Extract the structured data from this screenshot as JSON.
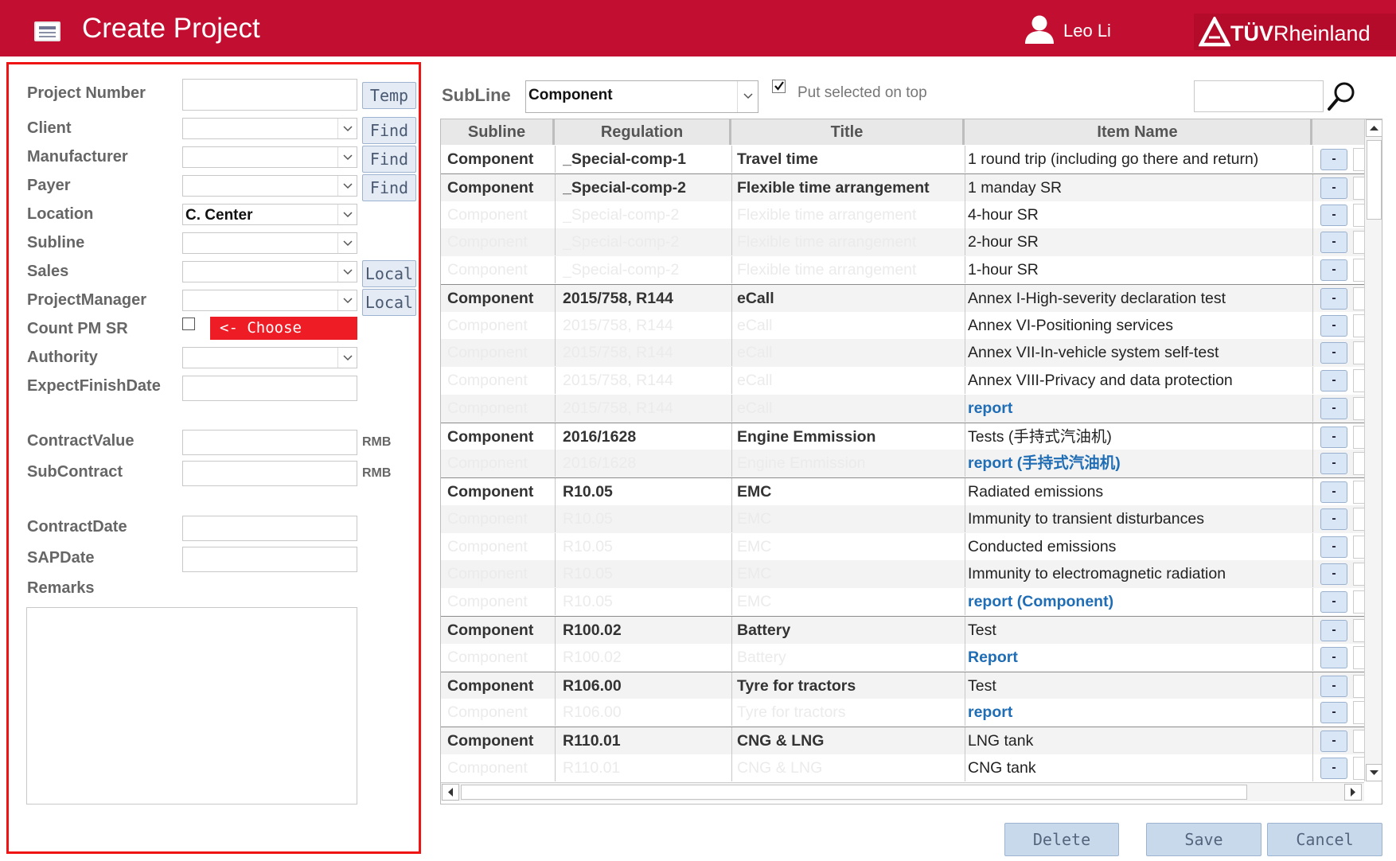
{
  "header": {
    "title": "Create Project",
    "user_name": "Leo Li",
    "logo_text_bold": "TÜV",
    "logo_text": "Rheinland"
  },
  "form": {
    "project_number": {
      "label": "Project Number",
      "value": "",
      "button": "Temp"
    },
    "client": {
      "label": "Client",
      "value": "",
      "button": "Find"
    },
    "manufacturer": {
      "label": "Manufacturer",
      "value": "",
      "button": "Find"
    },
    "payer": {
      "label": "Payer",
      "value": "",
      "button": "Find"
    },
    "location": {
      "label": "Location",
      "value": "C. Center"
    },
    "subline": {
      "label": "Subline",
      "value": ""
    },
    "sales": {
      "label": "Sales",
      "value": "",
      "button": "Local"
    },
    "project_manager": {
      "label": "ProjectManager",
      "value": "",
      "button": "Local"
    },
    "count_pm_sr": {
      "label": "Count PM SR",
      "checked": false,
      "hint": "<- Choose"
    },
    "authority": {
      "label": "Authority",
      "value": ""
    },
    "expect_finish_date": {
      "label": "ExpectFinishDate",
      "value": ""
    },
    "contract_value": {
      "label": "ContractValue",
      "value": "",
      "unit": "RMB"
    },
    "sub_contract": {
      "label": "SubContract",
      "value": "",
      "unit": "RMB"
    },
    "contract_date": {
      "label": "ContractDate",
      "value": ""
    },
    "sap_date": {
      "label": "SAPDate",
      "value": ""
    },
    "remarks": {
      "label": "Remarks",
      "value": ""
    }
  },
  "filter": {
    "subline_label": "SubLine",
    "subline_value": "Component",
    "put_selected_on_top_label": "Put selected on top",
    "put_selected_on_top_checked": true,
    "search_value": ""
  },
  "grid": {
    "columns": [
      "Subline",
      "Regulation",
      "Title",
      "Item Name"
    ],
    "row_button_label": "-",
    "rows": [
      {
        "subline": "Component",
        "regulation": "_Special-comp-1",
        "title": "Travel time",
        "item": "1 round trip (including go there and return)",
        "group_start": true,
        "link": false
      },
      {
        "subline": "Component",
        "regulation": "_Special-comp-2",
        "title": "Flexible time arrangement",
        "item": "1 manday SR",
        "group_start": true,
        "link": false
      },
      {
        "subline": "Component",
        "regulation": "_Special-comp-2",
        "title": "Flexible time arrangement",
        "item": "4-hour SR",
        "group_start": false,
        "link": false
      },
      {
        "subline": "Component",
        "regulation": "_Special-comp-2",
        "title": "Flexible time arrangement",
        "item": "2-hour SR",
        "group_start": false,
        "link": false
      },
      {
        "subline": "Component",
        "regulation": "_Special-comp-2",
        "title": "Flexible time arrangement",
        "item": "1-hour SR",
        "group_start": false,
        "link": false
      },
      {
        "subline": "Component",
        "regulation": "2015/758, R144",
        "title": "eCall",
        "item": "Annex I-High-severity declaration test",
        "group_start": true,
        "link": false
      },
      {
        "subline": "Component",
        "regulation": "2015/758, R144",
        "title": "eCall",
        "item": "Annex VI-Positioning services",
        "group_start": false,
        "link": false
      },
      {
        "subline": "Component",
        "regulation": "2015/758, R144",
        "title": "eCall",
        "item": "Annex VII-In-vehicle system self-test",
        "group_start": false,
        "link": false
      },
      {
        "subline": "Component",
        "regulation": "2015/758, R144",
        "title": "eCall",
        "item": "Annex VIII-Privacy and data protection",
        "group_start": false,
        "link": false
      },
      {
        "subline": "Component",
        "regulation": "2015/758, R144",
        "title": "eCall",
        "item": "report",
        "group_start": false,
        "link": true
      },
      {
        "subline": "Component",
        "regulation": "2016/1628",
        "title": "Engine Emmission",
        "item": "Tests (手持式汽油机)",
        "group_start": true,
        "link": false
      },
      {
        "subline": "Component",
        "regulation": "2016/1628",
        "title": "Engine Emmission",
        "item": "report (手持式汽油机)",
        "group_start": false,
        "link": true
      },
      {
        "subline": "Component",
        "regulation": "R10.05",
        "title": "EMC",
        "item": "Radiated emissions",
        "group_start": true,
        "link": false
      },
      {
        "subline": "Component",
        "regulation": "R10.05",
        "title": "EMC",
        "item": "Immunity to transient disturbances",
        "group_start": false,
        "link": false
      },
      {
        "subline": "Component",
        "regulation": "R10.05",
        "title": "EMC",
        "item": "Conducted emissions",
        "group_start": false,
        "link": false
      },
      {
        "subline": "Component",
        "regulation": "R10.05",
        "title": "EMC",
        "item": "Immunity to electromagnetic radiation",
        "group_start": false,
        "link": false
      },
      {
        "subline": "Component",
        "regulation": "R10.05",
        "title": "EMC",
        "item": "report (Component)",
        "group_start": false,
        "link": true
      },
      {
        "subline": "Component",
        "regulation": "R100.02",
        "title": "Battery",
        "item": "Test",
        "group_start": true,
        "link": false
      },
      {
        "subline": "Component",
        "regulation": "R100.02",
        "title": "Battery",
        "item": "Report",
        "group_start": false,
        "link": true
      },
      {
        "subline": "Component",
        "regulation": "R106.00",
        "title": "Tyre for tractors",
        "item": "Test",
        "group_start": true,
        "link": false
      },
      {
        "subline": "Component",
        "regulation": "R106.00",
        "title": "Tyre for tractors",
        "item": "report",
        "group_start": false,
        "link": true
      },
      {
        "subline": "Component",
        "regulation": "R110.01",
        "title": "CNG & LNG",
        "item": "LNG tank",
        "group_start": true,
        "link": false
      },
      {
        "subline": "Component",
        "regulation": "R110.01",
        "title": "CNG & LNG",
        "item": "CNG tank",
        "group_start": false,
        "link": false
      }
    ]
  },
  "actions": {
    "delete": "Delete",
    "save": "Save",
    "cancel": "Cancel"
  },
  "colors": {
    "header_red": "#c20e30",
    "highlight_border": "#f01313",
    "choose_hint_bg": "#ee1c25",
    "link_blue": "#1f6db5"
  }
}
